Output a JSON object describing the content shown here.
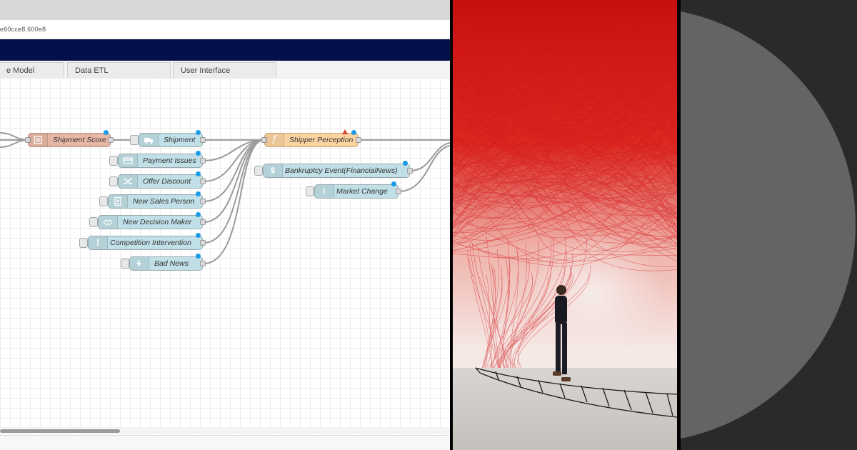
{
  "browser": {
    "url_fragment": "e60cce8.600e8"
  },
  "tabs": [
    {
      "label": "e Model"
    },
    {
      "label": "Data ETL"
    },
    {
      "label": "User Interface"
    }
  ],
  "nodes": {
    "shipment_score": "Shipment Score",
    "shipment": "Shipment",
    "payment_issues": "Payment Issues",
    "offer_discount": "Offer Discount",
    "new_sales_person": "New Sales Person",
    "new_decision_maker": "New Decision Maker",
    "competition_intervention": "Competition Intervention",
    "bad_news": "Bad News",
    "shipper_perception": "Shipper Perception",
    "bankruptcy_event": "Bankruptcy Event(FinancialNews)",
    "market_change": "Market Change"
  },
  "icons": {
    "score": "list-icon",
    "shipment": "truck-icon",
    "payment": "card-icon",
    "offer": "shuffle-icon",
    "sales": "person-icon",
    "decision": "handshake-icon",
    "competition": "exclamation-icon",
    "news": "lightning-icon",
    "function": "function-icon",
    "bankruptcy": "dollar-icon",
    "market": "info-icon"
  },
  "colors": {
    "header": "#04104a",
    "input_node": "#c0dfe6",
    "score_node": "#e7b7a5",
    "function_node": "#fbd3a0",
    "status_dot": "#1a9be8",
    "thread_red": "#e3201b",
    "disc_gray": "#646464"
  }
}
